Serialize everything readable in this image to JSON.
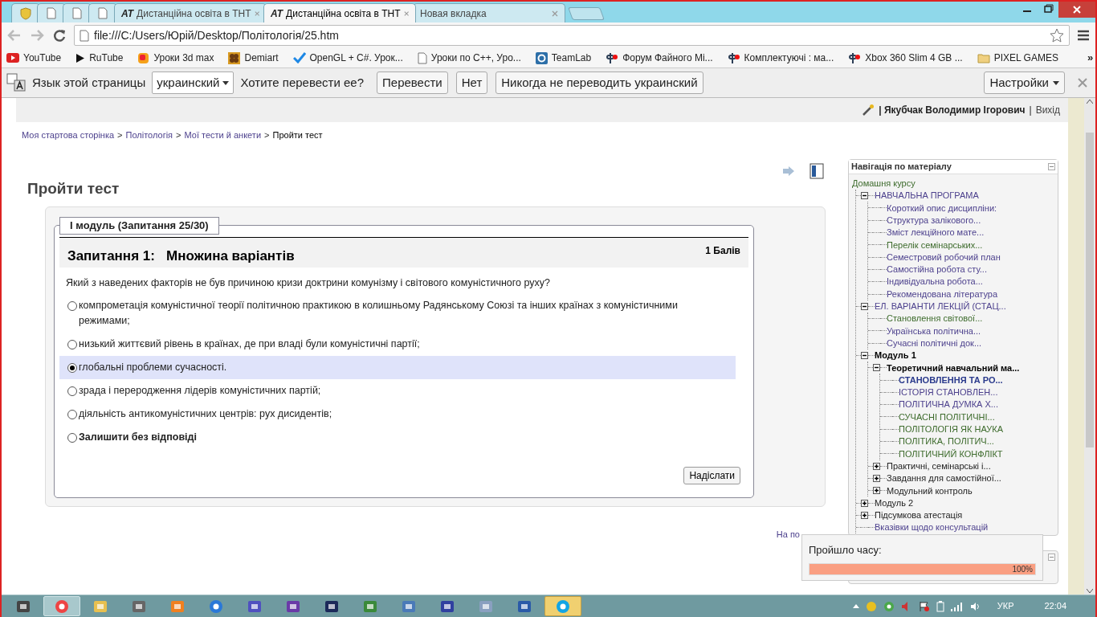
{
  "browser": {
    "tabs": [
      {
        "kind": "icon",
        "selected": false
      },
      {
        "kind": "icon",
        "selected": false
      },
      {
        "kind": "icon",
        "selected": false
      },
      {
        "kind": "icon",
        "selected": false
      },
      {
        "kind": "titled",
        "badge": "AT",
        "title": "Дистанційна освіта в ТНТ",
        "selected": false
      },
      {
        "kind": "titled",
        "badge": "AT",
        "title": "Дистанційна освіта в ТНТ",
        "selected": true
      },
      {
        "kind": "titled",
        "title": "Новая вкладка",
        "selected": false
      }
    ],
    "address": "file:///C:/Users/Юрій/Desktop/Політологія/25.htm",
    "bookmarks": [
      {
        "label": "YouTube"
      },
      {
        "label": "RuTube"
      },
      {
        "label": "Уроки 3d max"
      },
      {
        "label": "Demiart"
      },
      {
        "label": "OpenGL + C#. Урок..."
      },
      {
        "label": "Уроки по С++, Уро..."
      },
      {
        "label": "TeamLab"
      },
      {
        "label": "Форум Файного Мі..."
      },
      {
        "label": "Комплектуючі : ма..."
      },
      {
        "label": "Xbox 360 Slim 4 GB ..."
      },
      {
        "label": "PIXEL GAMES"
      }
    ],
    "bookmarks_more": "»",
    "translate_bar": {
      "prompt": "Язык этой страницы",
      "language": "украинский",
      "question": "Хотите перевести ее?",
      "buttons": [
        "Перевести",
        "Нет",
        "Никогда не переводить украинский"
      ],
      "settings": "Настройки"
    }
  },
  "page": {
    "user_prefix": "|",
    "user": "Якубчак Володимир Ігорович",
    "separator": "|",
    "logout": "Вихід",
    "breadcrumb": [
      {
        "label": "Моя стартова сторінка",
        "link": true
      },
      {
        "label": "Політологія",
        "link": true
      },
      {
        "label": "Мої тести й анкети",
        "link": true
      },
      {
        "label": "Пройти тест",
        "link": false
      }
    ],
    "breadcrumb_separator": ">",
    "title": "Пройти тест",
    "legend": "I модуль (Запитання 25/30)",
    "question_title": "Запитання 1:   Множина варіантів",
    "points": "1 Балів",
    "question_text": "Який з наведених факторів не був причиною кризи доктрини комунізму і світового комуністичного руху?",
    "options": [
      {
        "kind": "answer",
        "label": "компрометація комуністичної теорії політичною практикою в колишньому Радянському Союзі та інших країнах з комуністичними режимами;",
        "selected": false
      },
      {
        "kind": "answer",
        "label": "низький життєвий рівень в країнах, де при владі були комуністичні партії;",
        "selected": false
      },
      {
        "kind": "answer",
        "label": "глобальні проблеми сучасності.",
        "selected": true
      },
      {
        "kind": "answer",
        "label": "зрада і переродження лідерів комуністичних партій;",
        "selected": false
      },
      {
        "kind": "answer",
        "label": "діяльність антикомуністичних центрів: рух дисидентів;",
        "selected": false
      },
      {
        "kind": "skip",
        "label": "Залишити без відповіді",
        "selected": false
      }
    ],
    "submit": "Надіслати",
    "footer_partial": "На по"
  },
  "navigation": {
    "title": "Навігація по матеріалу",
    "home": "Домашня курсу",
    "tree": [
      {
        "kind": "link",
        "label": "НАВЧАЛЬНА ПРОГРАМА",
        "expanded": true,
        "visited": false,
        "children": [
          {
            "kind": "link",
            "label": "Короткий опис дисципліни:",
            "visited": false
          },
          {
            "kind": "link",
            "label": "Структура залікового...",
            "visited": false
          },
          {
            "kind": "link",
            "label": "Зміст лекційного мате...",
            "visited": false
          },
          {
            "kind": "link",
            "label": "Перелік семінарських...",
            "visited": true
          },
          {
            "kind": "link",
            "label": "Семестровий робочий план",
            "visited": false
          },
          {
            "kind": "link",
            "label": "Самостійна робота сту...",
            "visited": false
          },
          {
            "kind": "link",
            "label": "Індивідуальна робота...",
            "visited": false
          },
          {
            "kind": "link",
            "label": "Рекомендована література",
            "visited": false
          }
        ]
      },
      {
        "kind": "link",
        "label": "ЕЛ. ВАРІАНТИ ЛЕКЦІЙ (СТАЦ...",
        "expanded": true,
        "visited": false,
        "children": [
          {
            "kind": "link",
            "label": "Становлення світової...",
            "visited": true
          },
          {
            "kind": "link",
            "label": "Українська політична...",
            "visited": false
          },
          {
            "kind": "link",
            "label": "Сучасні політичні док...",
            "visited": false
          }
        ]
      },
      {
        "kind": "section",
        "label": "Модуль 1",
        "current": true,
        "expanded": true,
        "children": [
          {
            "kind": "section",
            "label": "Теоретичний навчальний ма...",
            "current": true,
            "expanded": true,
            "children": [
              {
                "kind": "link",
                "label": "СТАНОВЛЕННЯ ТА РО...",
                "current": true,
                "visited": false
              },
              {
                "kind": "link",
                "label": "ІСТОРІЯ СТАНОВЛЕН...",
                "current": false,
                "visited": false
              },
              {
                "kind": "link",
                "label": "ПОЛІТИЧНА ДУМКА Х...",
                "current": false,
                "visited": false
              },
              {
                "kind": "link",
                "label": "СУЧАСНІ ПОЛІТИЧНІ...",
                "current": false,
                "visited": true
              },
              {
                "kind": "link",
                "label": "ПОЛІТОЛОГІЯ ЯК НАУКА",
                "current": false,
                "visited": true
              },
              {
                "kind": "link",
                "label": "ПОЛІТИКА, ПОЛІТИЧ...",
                "current": false,
                "visited": true
              },
              {
                "kind": "link",
                "label": "ПОЛІТИЧНИЙ КОНФЛІКТ",
                "current": false,
                "visited": true
              }
            ]
          },
          {
            "kind": "section",
            "label": "Практичні, семінарські і...",
            "current": false,
            "expanded": false
          },
          {
            "kind": "section",
            "label": "Завдання для самостійної...",
            "current": false,
            "expanded": false
          },
          {
            "kind": "section",
            "label": "Модульний контроль",
            "current": false,
            "expanded": false
          }
        ]
      },
      {
        "kind": "section",
        "label": "Модуль 2",
        "current": false,
        "expanded": false
      },
      {
        "kind": "section",
        "label": "Підсумкова атестація",
        "current": false,
        "expanded": false
      },
      {
        "kind": "link",
        "label": "Вказівки щодо консультацій",
        "visited": false
      }
    ]
  },
  "timer": {
    "label": "Пройшло часу:",
    "level": 1,
    "reading": "100%"
  },
  "taskbar": {
    "apps": [
      {
        "active": false,
        "flashing": false
      },
      {
        "active": true,
        "flashing": false
      },
      {
        "active": false,
        "flashing": false
      },
      {
        "active": false,
        "flashing": false
      },
      {
        "active": false,
        "flashing": false
      },
      {
        "active": false,
        "flashing": false
      },
      {
        "active": false,
        "flashing": false
      },
      {
        "active": false,
        "flashing": false
      },
      {
        "active": false,
        "flashing": false
      },
      {
        "active": false,
        "flashing": false
      },
      {
        "active": false,
        "flashing": false
      },
      {
        "active": false,
        "flashing": false
      },
      {
        "active": false,
        "flashing": false
      },
      {
        "active": false,
        "flashing": false
      },
      {
        "active": false,
        "flashing": true
      }
    ],
    "language": "УКР",
    "time": "22:04"
  }
}
